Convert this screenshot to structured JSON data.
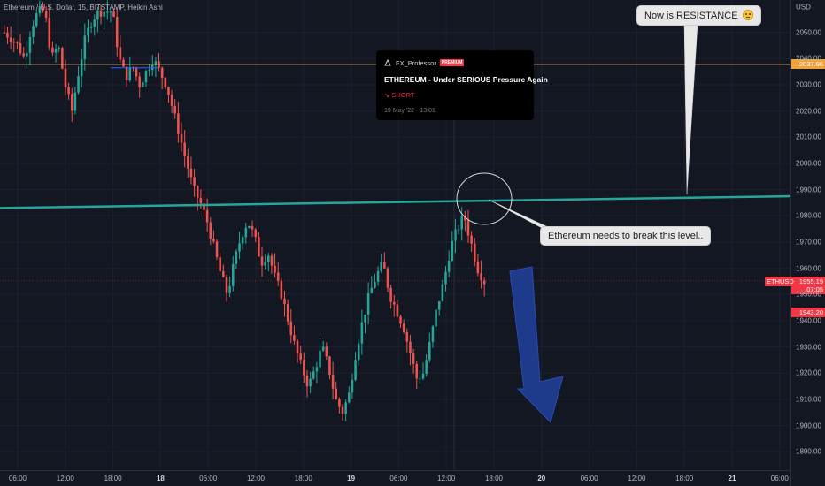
{
  "symbol_line": "Ethereum / U.S. Dollar, 15, BITSTAMP, Heikin Ashi",
  "price_axis": {
    "currency": "USD",
    "ticks": [
      2050,
      2040,
      2030,
      2020,
      2010,
      2000,
      1990,
      1980,
      1970,
      1960,
      1950,
      1940,
      1930,
      1920,
      1910,
      1900,
      1890
    ]
  },
  "time_axis": {
    "labels": [
      {
        "text": "06:00",
        "bold": false
      },
      {
        "text": "12:00",
        "bold": false
      },
      {
        "text": "18:00",
        "bold": false
      },
      {
        "text": "18",
        "bold": true
      },
      {
        "text": "06:00",
        "bold": false
      },
      {
        "text": "12:00",
        "bold": false
      },
      {
        "text": "18:00",
        "bold": false
      },
      {
        "text": "19",
        "bold": true
      },
      {
        "text": "06:00",
        "bold": false
      },
      {
        "text": "12:00",
        "bold": false
      },
      {
        "text": "18:00",
        "bold": false
      },
      {
        "text": "20",
        "bold": true
      },
      {
        "text": "06:00",
        "bold": false
      },
      {
        "text": "12:00",
        "bold": false
      },
      {
        "text": "18:00",
        "bold": false
      },
      {
        "text": "21",
        "bold": true
      },
      {
        "text": "06:00",
        "bold": false
      }
    ]
  },
  "price_badges": {
    "marked_level": {
      "value": "2037.96",
      "color": "#f0a23b",
      "line_price": 2037.96
    },
    "symbol_tag": {
      "text": "ETHUSD",
      "color": "#f23645"
    },
    "last_price": {
      "value": "1955.19",
      "countdown": "07:05",
      "color": "#f23645",
      "line_price": 1955.19
    },
    "low_price": {
      "value": "1943.20",
      "color": "#f23645",
      "line_price": 1943.2
    }
  },
  "idea_card": {
    "author": "FX_Professor",
    "badge": "PREMIUM",
    "title": "ETHEREUM - Under SERIOUS Pressure Again",
    "direction": "↘ SHORT",
    "date": "19 May '22 - 13:01"
  },
  "callouts": {
    "resistance": "Now is RESISTANCE",
    "break_level": "Ethereum needs to break this level.."
  },
  "colors": {
    "background": "#131722",
    "up_candle": "#26a69a",
    "down_candle": "#ef5350",
    "trend_line": "#26a69a",
    "arrow": "#1e3a8a",
    "level_line": "#f0a23b"
  },
  "chart_data": {
    "type": "candlestick",
    "title": "Ethereum / U.S. Dollar, 15, BITSTAMP, Heikin Ashi",
    "ylim": [
      1883,
      2060
    ],
    "resistance_line": {
      "start_price": 1983,
      "end_price": 1987.5
    },
    "projection": "downward arrow",
    "close_path": [
      [
        0,
        2050
      ],
      [
        1,
        2048
      ],
      [
        2,
        2045
      ],
      [
        3,
        2040
      ],
      [
        4,
        2052
      ],
      [
        5,
        2058
      ],
      [
        6,
        2058
      ],
      [
        7,
        2040
      ],
      [
        8,
        2045
      ],
      [
        9,
        2030
      ],
      [
        10,
        2020
      ],
      [
        11,
        2035
      ],
      [
        12,
        2048
      ],
      [
        13,
        2055
      ],
      [
        14,
        2058
      ],
      [
        15,
        2058
      ],
      [
        16,
        2058
      ],
      [
        17,
        2040
      ],
      [
        18,
        2033
      ],
      [
        19,
        2037
      ],
      [
        20,
        2030
      ],
      [
        21,
        2035
      ],
      [
        22,
        2040
      ],
      [
        23,
        2035
      ],
      [
        24,
        2030
      ],
      [
        25,
        2020
      ],
      [
        26,
        2010
      ],
      [
        27,
        2000
      ],
      [
        28,
        1990
      ],
      [
        29,
        1985
      ],
      [
        30,
        1978
      ],
      [
        31,
        1968
      ],
      [
        32,
        1958
      ],
      [
        33,
        1950
      ],
      [
        34,
        1962
      ],
      [
        35,
        1972
      ],
      [
        36,
        1978
      ],
      [
        37,
        1972
      ],
      [
        38,
        1962
      ],
      [
        39,
        1966
      ],
      [
        40,
        1957
      ],
      [
        41,
        1950
      ],
      [
        42,
        1940
      ],
      [
        43,
        1930
      ],
      [
        44,
        1922
      ],
      [
        45,
        1915
      ],
      [
        46,
        1922
      ],
      [
        47,
        1930
      ],
      [
        48,
        1922
      ],
      [
        49,
        1910
      ],
      [
        50,
        1905
      ],
      [
        51,
        1912
      ],
      [
        52,
        1928
      ],
      [
        53,
        1940
      ],
      [
        54,
        1950
      ],
      [
        55,
        1957
      ],
      [
        56,
        1962
      ],
      [
        57,
        1950
      ],
      [
        58,
        1944
      ],
      [
        59,
        1938
      ],
      [
        60,
        1928
      ],
      [
        61,
        1918
      ],
      [
        62,
        1920
      ],
      [
        63,
        1932
      ],
      [
        64,
        1945
      ],
      [
        65,
        1955
      ],
      [
        66,
        1968
      ],
      [
        67,
        1975
      ],
      [
        68,
        1980
      ],
      [
        69,
        1970
      ],
      [
        70,
        1960
      ],
      [
        71,
        1955
      ]
    ]
  }
}
